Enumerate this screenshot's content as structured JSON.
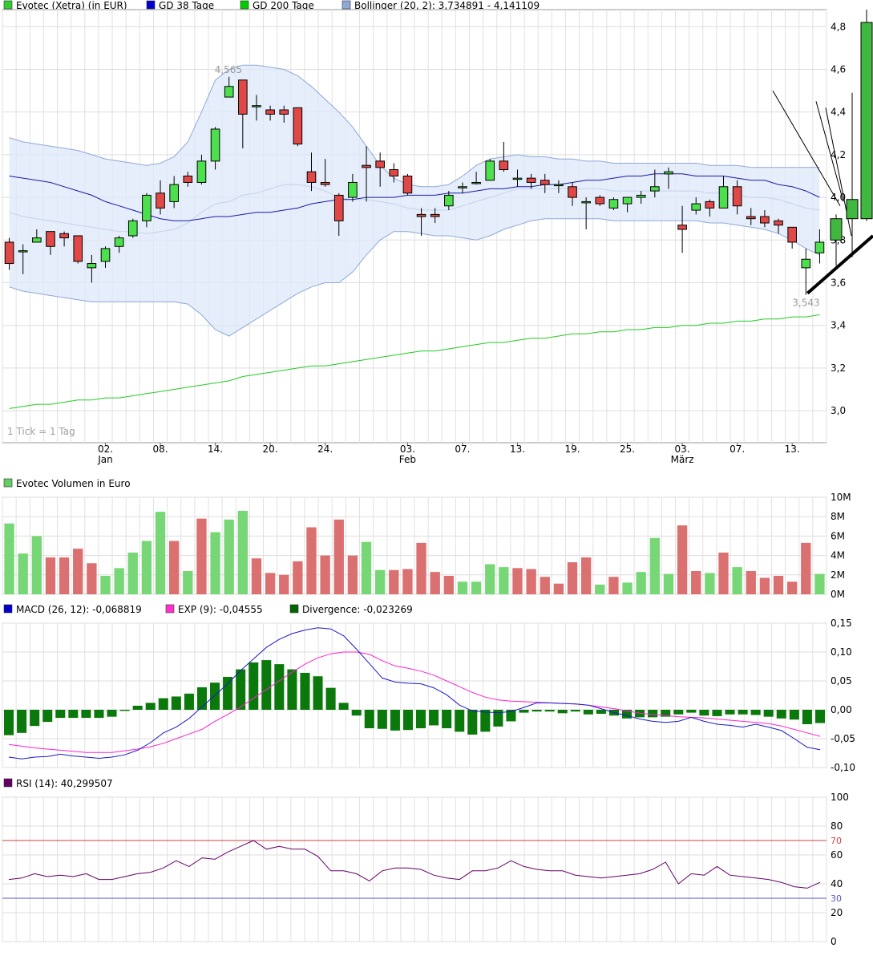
{
  "legend_price": [
    {
      "label": "Evotec (Xetra) (in EUR)",
      "color": "#33cc33"
    },
    {
      "label": "GD 38 Tage",
      "color": "#0000cc"
    },
    {
      "label": "GD 200 Tage",
      "color": "#00cc00"
    },
    {
      "label": "Bollinger (20, 2): 3,734891  -  4,141109",
      "color": "#8fa8d8"
    }
  ],
  "legend_volume": [
    {
      "label": "Evotec Volumen in Euro",
      "color": "#66cc66"
    }
  ],
  "legend_macd": [
    {
      "label": "MACD (26, 12): -0,068819",
      "color": "#0000cc"
    },
    {
      "label": "EXP (9): -0,04555",
      "color": "#ff33cc"
    },
    {
      "label": "Divergence: -0,023269",
      "color": "#006600"
    }
  ],
  "legend_rsi": [
    {
      "label": "RSI (14): 40,299507",
      "color": "#660066"
    }
  ],
  "tick_note": "1 Tick = 1 Tag",
  "annotation_high": "4,565",
  "annotation_low": "3,543",
  "x_ticks": [
    {
      "i": 7,
      "label": "02."
    },
    {
      "i": 11,
      "label": "08."
    },
    {
      "i": 15,
      "label": "14."
    },
    {
      "i": 19,
      "label": "20."
    },
    {
      "i": 23,
      "label": "24."
    },
    {
      "i": 29,
      "label": "03."
    },
    {
      "i": 33,
      "label": "07."
    },
    {
      "i": 37,
      "label": "13."
    },
    {
      "i": 41,
      "label": "19."
    },
    {
      "i": 45,
      "label": "25."
    },
    {
      "i": 49,
      "label": "03."
    },
    {
      "i": 53,
      "label": "07."
    },
    {
      "i": 57,
      "label": "13."
    }
  ],
  "month_labels": [
    {
      "i": 7,
      "label": "Jan"
    },
    {
      "i": 29,
      "label": "Feb"
    },
    {
      "i": 49,
      "label": "März"
    }
  ],
  "price_y_labels": [
    "3,0",
    "3,2",
    "3,4",
    "3,6",
    "3,8",
    "4,0",
    "4,2",
    "4,4",
    "4,6",
    "4,8"
  ],
  "volume_y_labels": [
    "0M",
    "2M",
    "4M",
    "6M",
    "8M",
    "10M"
  ],
  "macd_y_labels": [
    "-0,10",
    "-0,05",
    "0,00",
    "0,05",
    "0,10",
    "0,15"
  ],
  "rsi_y_labels": [
    "0",
    "20",
    "40",
    "60",
    "80",
    "100"
  ],
  "rsi_ref_labels": [
    {
      "value": 70,
      "label": "70",
      "color": "#cc4444"
    },
    {
      "value": 30,
      "label": "30",
      "color": "#5555cc"
    }
  ],
  "chart_data": [
    {
      "type": "candlestick",
      "title": "Evotec (Xetra) (in EUR)",
      "ylim": [
        2.85,
        4.88
      ],
      "candles": [
        {
          "o": 3.79,
          "c": 3.69,
          "h": 3.81,
          "l": 3.66
        },
        {
          "o": 3.75,
          "c": 3.75,
          "h": 3.78,
          "l": 3.64
        },
        {
          "o": 3.79,
          "c": 3.81,
          "h": 3.85,
          "l": 3.79
        },
        {
          "o": 3.84,
          "c": 3.77,
          "h": 3.84,
          "l": 3.73
        },
        {
          "o": 3.83,
          "c": 3.81,
          "h": 3.84,
          "l": 3.77
        },
        {
          "o": 3.82,
          "c": 3.7,
          "h": 3.82,
          "l": 3.69
        },
        {
          "o": 3.67,
          "c": 3.69,
          "h": 3.73,
          "l": 3.6
        },
        {
          "o": 3.7,
          "c": 3.76,
          "h": 3.77,
          "l": 3.67
        },
        {
          "o": 3.77,
          "c": 3.81,
          "h": 3.82,
          "l": 3.74
        },
        {
          "o": 3.82,
          "c": 3.89,
          "h": 3.9,
          "l": 3.81
        },
        {
          "o": 3.89,
          "c": 4.01,
          "h": 4.02,
          "l": 3.86
        },
        {
          "o": 4.02,
          "c": 3.95,
          "h": 4.08,
          "l": 3.92
        },
        {
          "o": 3.98,
          "c": 4.06,
          "h": 4.1,
          "l": 3.95
        },
        {
          "o": 4.1,
          "c": 4.07,
          "h": 4.12,
          "l": 4.05
        },
        {
          "o": 4.07,
          "c": 4.17,
          "h": 4.2,
          "l": 4.06
        },
        {
          "o": 4.17,
          "c": 4.32,
          "h": 4.33,
          "l": 4.13
        },
        {
          "o": 4.47,
          "c": 4.52,
          "h": 4.565,
          "l": 4.47
        },
        {
          "o": 4.55,
          "c": 4.39,
          "h": 4.55,
          "l": 4.23
        },
        {
          "o": 4.43,
          "c": 4.43,
          "h": 4.48,
          "l": 4.36
        },
        {
          "o": 4.41,
          "c": 4.39,
          "h": 4.43,
          "l": 4.36
        },
        {
          "o": 4.41,
          "c": 4.39,
          "h": 4.43,
          "l": 4.35
        },
        {
          "o": 4.42,
          "c": 4.25,
          "h": 4.42,
          "l": 4.24
        },
        {
          "o": 4.12,
          "c": 4.07,
          "h": 4.21,
          "l": 4.03
        },
        {
          "o": 4.07,
          "c": 4.06,
          "h": 4.18,
          "l": 4.05
        },
        {
          "o": 4.01,
          "c": 3.89,
          "h": 4.02,
          "l": 3.82
        },
        {
          "o": 4.0,
          "c": 4.07,
          "h": 4.11,
          "l": 3.98
        },
        {
          "o": 4.15,
          "c": 4.14,
          "h": 4.24,
          "l": 3.98
        },
        {
          "o": 4.17,
          "c": 4.14,
          "h": 4.21,
          "l": 4.05
        },
        {
          "o": 4.13,
          "c": 4.1,
          "h": 4.16,
          "l": 4.07
        },
        {
          "o": 4.1,
          "c": 4.02,
          "h": 4.11,
          "l": 4.01
        },
        {
          "o": 3.92,
          "c": 3.91,
          "h": 3.95,
          "l": 3.82
        },
        {
          "o": 3.92,
          "c": 3.91,
          "h": 3.95,
          "l": 3.88
        },
        {
          "o": 3.96,
          "c": 4.01,
          "h": 4.03,
          "l": 3.94
        },
        {
          "o": 4.05,
          "c": 4.05,
          "h": 4.07,
          "l": 4.02
        },
        {
          "o": 4.07,
          "c": 4.07,
          "h": 4.12,
          "l": 4.06
        },
        {
          "o": 4.08,
          "c": 4.17,
          "h": 4.18,
          "l": 4.08
        },
        {
          "o": 4.17,
          "c": 4.13,
          "h": 4.26,
          "l": 4.12
        },
        {
          "o": 4.09,
          "c": 4.09,
          "h": 4.13,
          "l": 4.05
        },
        {
          "o": 4.09,
          "c": 4.07,
          "h": 4.11,
          "l": 4.04
        },
        {
          "o": 4.08,
          "c": 4.06,
          "h": 4.11,
          "l": 4.02
        },
        {
          "o": 4.06,
          "c": 4.06,
          "h": 4.08,
          "l": 4.02
        },
        {
          "o": 4.05,
          "c": 4.0,
          "h": 4.07,
          "l": 3.96
        },
        {
          "o": 3.98,
          "c": 3.98,
          "h": 4.0,
          "l": 3.85
        },
        {
          "o": 4.0,
          "c": 3.97,
          "h": 4.01,
          "l": 3.96
        },
        {
          "o": 3.95,
          "c": 3.99,
          "h": 4.0,
          "l": 3.94
        },
        {
          "o": 3.97,
          "c": 4.0,
          "h": 4.0,
          "l": 3.93
        },
        {
          "o": 4.0,
          "c": 4.01,
          "h": 4.03,
          "l": 3.97
        },
        {
          "o": 4.03,
          "c": 4.05,
          "h": 4.13,
          "l": 4.0
        },
        {
          "o": 4.11,
          "c": 4.12,
          "h": 4.14,
          "l": 4.04
        },
        {
          "o": 3.87,
          "c": 3.85,
          "h": 3.96,
          "l": 3.74
        },
        {
          "o": 3.94,
          "c": 3.97,
          "h": 4.0,
          "l": 3.92
        },
        {
          "o": 3.98,
          "c": 3.95,
          "h": 3.99,
          "l": 3.91
        },
        {
          "o": 3.95,
          "c": 4.05,
          "h": 4.1,
          "l": 3.95
        },
        {
          "o": 4.05,
          "c": 3.96,
          "h": 4.08,
          "l": 3.92
        },
        {
          "o": 3.91,
          "c": 3.9,
          "h": 3.95,
          "l": 3.87
        },
        {
          "o": 3.91,
          "c": 3.88,
          "h": 3.94,
          "l": 3.86
        },
        {
          "o": 3.89,
          "c": 3.87,
          "h": 3.9,
          "l": 3.83
        },
        {
          "o": 3.86,
          "c": 3.79,
          "h": 3.86,
          "l": 3.76
        },
        {
          "o": 3.67,
          "c": 3.71,
          "h": 3.76,
          "l": 3.543
        },
        {
          "o": 3.74,
          "c": 3.79,
          "h": 3.85,
          "l": 3.69
        }
      ],
      "gd38": [
        4.1,
        4.09,
        4.08,
        4.07,
        4.05,
        4.03,
        4.01,
        3.98,
        3.96,
        3.94,
        3.92,
        3.9,
        3.89,
        3.89,
        3.9,
        3.91,
        3.91,
        3.92,
        3.93,
        3.93,
        3.94,
        3.95,
        3.97,
        3.98,
        3.99,
        3.99,
        4.0,
        4.0,
        4.0,
        4.01,
        4.01,
        4.01,
        4.02,
        4.02,
        4.03,
        4.04,
        4.04,
        4.05,
        4.05,
        4.06,
        4.06,
        4.07,
        4.08,
        4.08,
        4.09,
        4.1,
        4.1,
        4.11,
        4.11,
        4.11,
        4.1,
        4.1,
        4.1,
        4.09,
        4.08,
        4.08,
        4.06,
        4.05,
        4.03,
        4.0
      ],
      "gd200": [
        3.01,
        3.02,
        3.03,
        3.03,
        3.04,
        3.05,
        3.05,
        3.06,
        3.06,
        3.07,
        3.08,
        3.09,
        3.1,
        3.11,
        3.12,
        3.13,
        3.14,
        3.16,
        3.17,
        3.18,
        3.19,
        3.2,
        3.21,
        3.21,
        3.22,
        3.23,
        3.24,
        3.25,
        3.26,
        3.27,
        3.28,
        3.28,
        3.29,
        3.3,
        3.31,
        3.32,
        3.32,
        3.33,
        3.34,
        3.34,
        3.35,
        3.36,
        3.36,
        3.37,
        3.37,
        3.38,
        3.38,
        3.39,
        3.39,
        3.4,
        3.4,
        3.41,
        3.41,
        3.42,
        3.42,
        3.43,
        3.43,
        3.44,
        3.44,
        3.45
      ],
      "bollinger_upper": [
        4.28,
        4.26,
        4.25,
        4.24,
        4.23,
        4.22,
        4.2,
        4.18,
        4.17,
        4.16,
        4.15,
        4.16,
        4.19,
        4.26,
        4.4,
        4.55,
        4.6,
        4.62,
        4.62,
        4.61,
        4.6,
        4.57,
        4.52,
        4.46,
        4.4,
        4.33,
        4.24,
        4.15,
        4.09,
        4.06,
        4.05,
        4.05,
        4.06,
        4.1,
        4.15,
        4.18,
        4.19,
        4.2,
        4.19,
        4.19,
        4.18,
        4.18,
        4.17,
        4.17,
        4.16,
        4.16,
        4.16,
        4.16,
        4.16,
        4.16,
        4.16,
        4.15,
        4.15,
        4.15,
        4.14,
        4.14,
        4.14,
        4.14,
        4.14,
        4.14
      ],
      "bollinger_lower": [
        3.58,
        3.56,
        3.55,
        3.54,
        3.53,
        3.52,
        3.51,
        3.51,
        3.51,
        3.51,
        3.51,
        3.51,
        3.51,
        3.5,
        3.45,
        3.38,
        3.35,
        3.39,
        3.43,
        3.47,
        3.51,
        3.55,
        3.58,
        3.6,
        3.6,
        3.65,
        3.73,
        3.8,
        3.84,
        3.84,
        3.83,
        3.82,
        3.82,
        3.81,
        3.8,
        3.82,
        3.85,
        3.87,
        3.89,
        3.9,
        3.9,
        3.9,
        3.9,
        3.9,
        3.89,
        3.89,
        3.89,
        3.89,
        3.89,
        3.89,
        3.89,
        3.88,
        3.88,
        3.87,
        3.86,
        3.85,
        3.83,
        3.8,
        3.76,
        3.73
      ],
      "bollinger_middle": [
        3.93,
        3.91,
        3.9,
        3.89,
        3.88,
        3.87,
        3.86,
        3.85,
        3.84,
        3.84,
        3.83,
        3.84,
        3.85,
        3.88,
        3.93,
        3.97,
        3.98,
        4.01,
        4.02,
        4.04,
        4.06,
        4.06,
        4.05,
        4.03,
        4.0,
        3.99,
        3.99,
        3.98,
        3.97,
        3.95,
        3.94,
        3.94,
        3.94,
        3.96,
        3.98,
        4.0,
        4.02,
        4.04,
        4.04,
        4.04,
        4.04,
        4.04,
        4.04,
        4.04,
        4.03,
        4.03,
        4.03,
        4.03,
        4.03,
        4.03,
        4.03,
        4.02,
        4.02,
        4.01,
        4.0,
        4.0,
        3.99,
        3.97,
        3.95,
        3.94
      ]
    },
    {
      "type": "bar",
      "title": "Evotec Volumen in Euro",
      "unit": "M",
      "ylim": [
        0,
        10
      ],
      "values": [
        7.3,
        4.2,
        6.0,
        3.8,
        3.8,
        4.7,
        3.2,
        1.9,
        2.7,
        4.3,
        5.5,
        8.5,
        5.5,
        2.4,
        7.8,
        6.4,
        7.7,
        8.6,
        3.7,
        2.2,
        2.0,
        3.4,
        6.9,
        4.0,
        7.7,
        4.0,
        5.4,
        2.5,
        2.5,
        2.6,
        5.3,
        2.3,
        1.9,
        1.3,
        1.3,
        3.1,
        2.8,
        2.7,
        2.6,
        1.8,
        1.1,
        3.3,
        3.8,
        1.0,
        1.8,
        1.2,
        2.3,
        5.8,
        2.1,
        7.1,
        2.4,
        2.2,
        4.3,
        2.8,
        2.4,
        1.7,
        1.9,
        1.3,
        5.3,
        2.1
      ],
      "up": [
        true,
        true,
        true,
        false,
        false,
        false,
        false,
        true,
        true,
        true,
        true,
        true,
        false,
        true,
        false,
        true,
        true,
        true,
        false,
        false,
        false,
        false,
        false,
        false,
        false,
        false,
        true,
        true,
        false,
        false,
        false,
        false,
        false,
        true,
        true,
        true,
        true,
        false,
        false,
        false,
        false,
        false,
        false,
        true,
        false,
        true,
        true,
        true,
        true,
        false,
        false,
        true,
        false,
        true,
        false,
        false,
        false,
        false,
        false,
        true
      ]
    },
    {
      "type": "line",
      "title": "MACD (26, 12) / EXP (9) / Divergence",
      "ylim": [
        -0.1,
        0.15
      ],
      "macd": [
        -0.082,
        -0.085,
        -0.082,
        -0.081,
        -0.077,
        -0.08,
        -0.082,
        -0.084,
        -0.082,
        -0.078,
        -0.07,
        -0.057,
        -0.04,
        -0.03,
        -0.015,
        0.005,
        0.025,
        0.045,
        0.068,
        0.088,
        0.108,
        0.122,
        0.132,
        0.138,
        0.142,
        0.14,
        0.128,
        0.105,
        0.08,
        0.055,
        0.048,
        0.046,
        0.045,
        0.038,
        0.026,
        0.008,
        -0.002,
        -0.004,
        -0.005,
        -0.003,
        0.004,
        0.012,
        0.012,
        0.011,
        0.01,
        0.008,
        0.002,
        -0.005,
        -0.01,
        -0.016,
        -0.02,
        -0.022,
        -0.02,
        -0.013,
        -0.02,
        -0.025,
        -0.027,
        -0.03,
        -0.025,
        -0.03,
        -0.036,
        -0.05,
        -0.065,
        -0.069
      ],
      "exp": [
        -0.06,
        -0.063,
        -0.066,
        -0.068,
        -0.07,
        -0.072,
        -0.074,
        -0.074,
        -0.074,
        -0.071,
        -0.068,
        -0.064,
        -0.058,
        -0.05,
        -0.042,
        -0.034,
        -0.02,
        -0.008,
        0.005,
        0.02,
        0.035,
        0.05,
        0.065,
        0.079,
        0.09,
        0.097,
        0.1,
        0.1,
        0.096,
        0.085,
        0.076,
        0.072,
        0.067,
        0.06,
        0.05,
        0.04,
        0.03,
        0.022,
        0.017,
        0.015,
        0.014,
        0.013,
        0.012,
        0.011,
        0.01,
        0.008,
        0.005,
        0.002,
        -0.002,
        -0.006,
        -0.008,
        -0.01,
        -0.012,
        -0.013,
        -0.014,
        -0.016,
        -0.018,
        -0.02,
        -0.022,
        -0.024,
        -0.028,
        -0.034,
        -0.04,
        -0.046
      ],
      "divergence": [
        -0.044,
        -0.04,
        -0.028,
        -0.021,
        -0.014,
        -0.014,
        -0.014,
        -0.014,
        -0.012,
        -0.002,
        0.007,
        0.012,
        0.02,
        0.023,
        0.028,
        0.039,
        0.047,
        0.057,
        0.07,
        0.082,
        0.086,
        0.079,
        0.07,
        0.064,
        0.058,
        0.038,
        0.012,
        -0.01,
        -0.032,
        -0.033,
        -0.036,
        -0.035,
        -0.032,
        -0.027,
        -0.032,
        -0.038,
        -0.043,
        -0.038,
        -0.029,
        -0.02,
        -0.005,
        -0.003,
        -0.003,
        -0.006,
        -0.003,
        -0.008,
        -0.007,
        -0.01,
        -0.015,
        -0.013,
        -0.013,
        -0.012,
        -0.008,
        -0.005,
        -0.01,
        -0.011,
        -0.008,
        -0.008,
        -0.009,
        -0.012,
        -0.015,
        -0.017,
        -0.025,
        -0.023
      ]
    },
    {
      "type": "line",
      "title": "RSI (14)",
      "ylim": [
        0,
        100
      ],
      "reference_lines": [
        70,
        30
      ],
      "values": [
        43,
        44,
        47,
        45,
        46,
        45,
        47,
        43,
        43,
        45,
        47,
        48,
        51,
        56,
        52,
        58,
        57,
        62,
        66,
        70,
        64,
        66,
        64,
        64,
        59,
        49,
        49,
        47,
        42,
        49,
        51,
        51,
        50,
        46,
        44,
        43,
        49,
        49,
        51,
        56,
        52,
        50,
        49,
        49,
        46,
        45,
        44,
        45,
        46,
        47,
        50,
        55,
        40,
        47,
        46,
        52,
        46,
        45,
        44,
        43,
        41,
        38,
        37,
        41
      ]
    }
  ]
}
